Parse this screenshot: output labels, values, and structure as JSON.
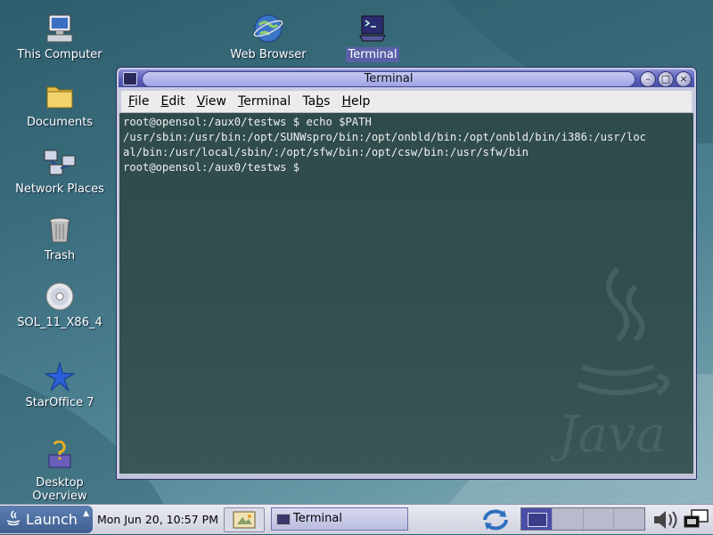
{
  "desktop": {
    "icons": [
      {
        "label": "This Computer",
        "icon": "computer-icon"
      },
      {
        "label": "Documents",
        "icon": "folder-icon"
      },
      {
        "label": "Network Places",
        "icon": "network-icon"
      },
      {
        "label": "Trash",
        "icon": "trash-icon"
      },
      {
        "label": "SOL_11_X86_4",
        "icon": "cd-icon"
      },
      {
        "label": "StarOffice 7",
        "icon": "staroffice-icon"
      },
      {
        "label": "Desktop Overview",
        "icon": "help-book-icon"
      },
      {
        "label": "Web Browser",
        "icon": "globe-icon"
      },
      {
        "label": "Terminal",
        "icon": "terminal-icon",
        "selected": true
      }
    ]
  },
  "window": {
    "title": "Terminal",
    "menu": [
      "File",
      "Edit",
      "View",
      "Terminal",
      "Tabs",
      "Help"
    ],
    "terminal_lines": [
      "root@opensol:/aux0/testws $ echo $PATH",
      "/usr/sbin:/usr/bin:/opt/SUNWspro/bin:/opt/onbld/bin:/opt/onbld/bin/i386:/usr/loc",
      "al/bin:/usr/local/sbin/:/opt/sfw/bin:/opt/csw/bin:/usr/sfw/bin",
      "root@opensol:/aux0/testws $ "
    ]
  },
  "panel": {
    "launch_label": "Launch",
    "clock": "Mon Jun 20, 10:57 PM",
    "task_label": "Terminal",
    "workspaces": 4,
    "active_workspace": 1
  },
  "colors": {
    "titlebar": "#5a5fb8",
    "terminal_bg": "#33504f",
    "terminal_fg": "#f0f0f0",
    "desktop": "#3a6d7d"
  }
}
